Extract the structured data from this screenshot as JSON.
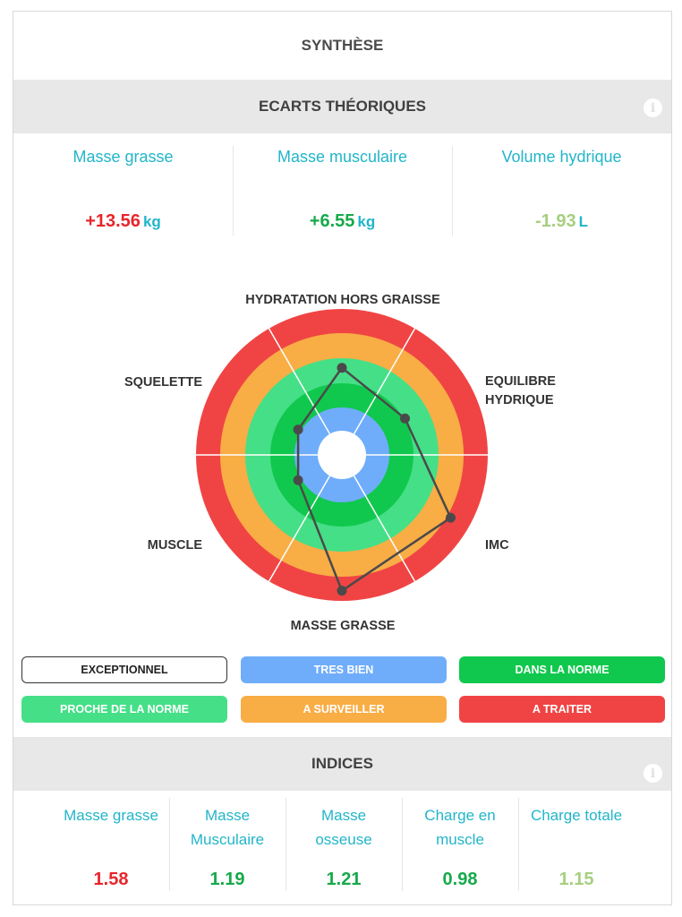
{
  "header": {
    "title": "SYNTHÈSE"
  },
  "ecarts": {
    "title": "ECARTS THÉORIQUES",
    "info_icon": "info-icon",
    "metrics": [
      {
        "label": "Masse grasse",
        "value": "+13.56",
        "unit": "kg",
        "color": "#e8252b"
      },
      {
        "label": "Masse musculaire",
        "value": "+6.55",
        "unit": "kg",
        "color": "#16a94a"
      },
      {
        "label": "Volume hydrique",
        "value": "-1.93",
        "unit": "L",
        "color": "#a6cf7f"
      }
    ]
  },
  "radar": {
    "axis_labels": [
      "HYDRATATION HORS GRAISSE",
      "EQUILIBRE HYDRIQUE",
      "IMC",
      "MASSE GRASSE",
      "MUSCLE",
      "SQUELETTE"
    ],
    "rings": [
      {
        "level": "A TRAITER",
        "color": "#f04444"
      },
      {
        "level": "A SURVEILLER",
        "color": "#f9ad45"
      },
      {
        "level": "PROCHE DE LA NORME",
        "color": "#45df87"
      },
      {
        "level": "DANS LA NORME",
        "color": "#10c84d"
      },
      {
        "level": "TRES BIEN",
        "color": "#6fadfa"
      }
    ],
    "ring_scale_max": 6,
    "points": [
      {
        "axis": "HYDRATATION HORS GRAISSE",
        "level": 3.1
      },
      {
        "axis": "EQUILIBRE HYDRIQUE",
        "level": 2.4
      },
      {
        "axis": "IMC",
        "level": 5.0
      },
      {
        "axis": "MASSE GRASSE",
        "level": 5.5
      },
      {
        "axis": "MUSCLE",
        "level": 1.3
      },
      {
        "axis": "SQUELETTE",
        "level": 1.3
      }
    ]
  },
  "legend": [
    {
      "label": "EXCEPTIONNEL",
      "color": "#ffffff",
      "text_color": "#222222"
    },
    {
      "label": "TRES BIEN",
      "color": "#6fadfa",
      "text_color": "#ffffff"
    },
    {
      "label": "DANS LA NORME",
      "color": "#10c84d",
      "text_color": "#ffffff"
    },
    {
      "label": "PROCHE DE LA NORME",
      "color": "#45df87",
      "text_color": "#ffffff"
    },
    {
      "label": "A SURVEILLER",
      "color": "#f9ad45",
      "text_color": "#ffffff"
    },
    {
      "label": "A TRAITER",
      "color": "#f04444",
      "text_color": "#ffffff"
    }
  ],
  "indices": {
    "title": "INDICES",
    "info_icon": "info-icon",
    "items": [
      {
        "label": "Masse grasse",
        "value": "1.58",
        "color": "#e8252b"
      },
      {
        "label": "Masse Musculaire",
        "value": "1.19",
        "color": "#16a94a"
      },
      {
        "label": "Masse osseuse",
        "value": "1.21",
        "color": "#16a94a"
      },
      {
        "label": "Charge en muscle",
        "value": "0.98",
        "color": "#16a94a"
      },
      {
        "label": "Charge totale",
        "value": "1.15",
        "color": "#a6cf7f"
      }
    ]
  }
}
